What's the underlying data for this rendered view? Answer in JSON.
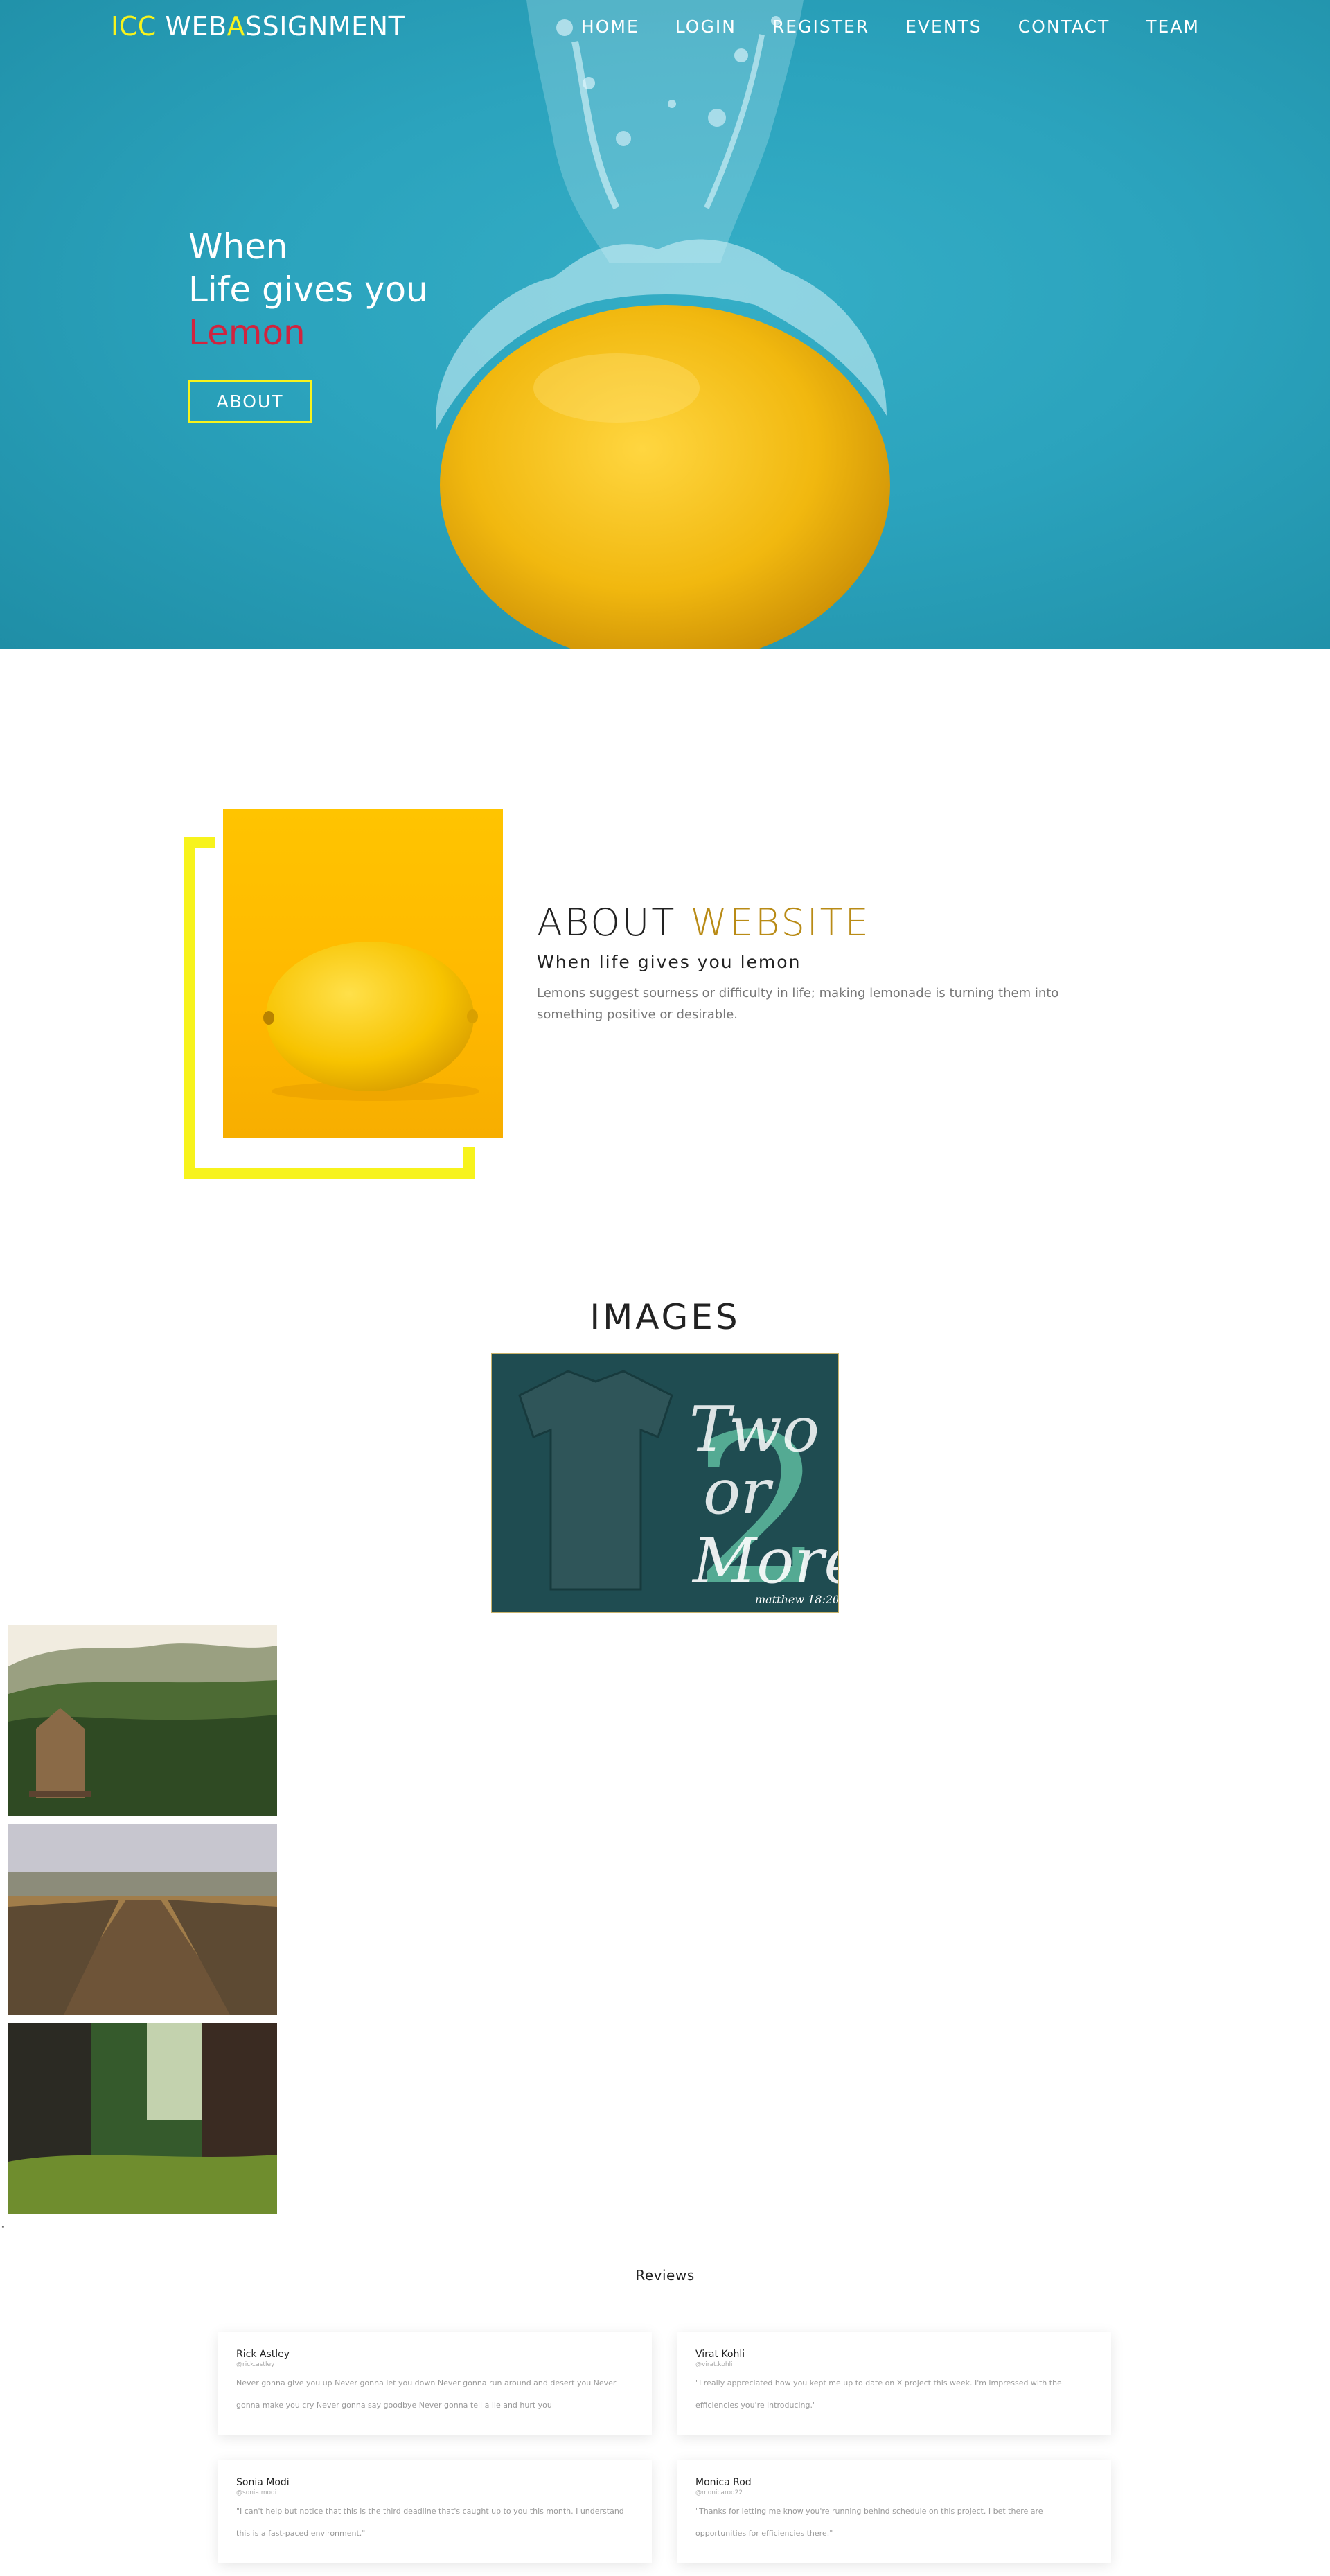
{
  "header": {
    "logo": {
      "part1": "ICC",
      "part2": "WEB",
      "part3": "A",
      "part4": "SSIGNMENT"
    },
    "nav": [
      "HOME",
      "LOGIN",
      "REGISTER",
      "EVENTS",
      "CONTACT",
      "TEAM"
    ]
  },
  "hero": {
    "line1": "When",
    "line2": "Life gives you",
    "line3": "Lemon",
    "button": "ABOUT"
  },
  "about": {
    "title_main": "ABOUT",
    "title_accent": "WEBSITE",
    "subtitle": "When life gives you lemon",
    "description": "Lemons suggest sourness or difficulty in life; making lemonade is turning them into something positive or desirable."
  },
  "images": {
    "title": "IMAGES",
    "tshirt_text": {
      "line1": "Two",
      "line2": "or",
      "line3": "More",
      "number": "2",
      "verse": "matthew 18:20"
    }
  },
  "stray_mark": "\"",
  "reviews": {
    "title": "Reviews",
    "items": [
      {
        "name": "Rick Astley",
        "handle": "@rick.astley",
        "text": "Never gonna give you up Never gonna let you down Never gonna run around and desert you Never gonna make you cry Never gonna say goodbye Never gonna tell a lie and hurt you"
      },
      {
        "name": "Virat Kohli",
        "handle": "@virat.kohli",
        "text": "\"I really appreciated how you kept me up to date on X project this week. I'm impressed with the efficiencies you're introducing.\""
      },
      {
        "name": "Sonia Modi",
        "handle": "@sonia.modi",
        "text": "\"I can't help but notice that this is the third deadline that's caught up to you this month. I understand this is a fast-paced environment.\""
      },
      {
        "name": "Monica Rod",
        "handle": "@monicarod22",
        "text": "\"Thanks for letting me know you're running behind schedule on this project. I bet there are opportunities for efficiencies there.\""
      }
    ]
  },
  "colors": {
    "hero_bg": "#2ba3bd",
    "accent_yellow": "#f7f31c",
    "lemon_red": "#d0243f",
    "about_gold": "#b98b16"
  }
}
